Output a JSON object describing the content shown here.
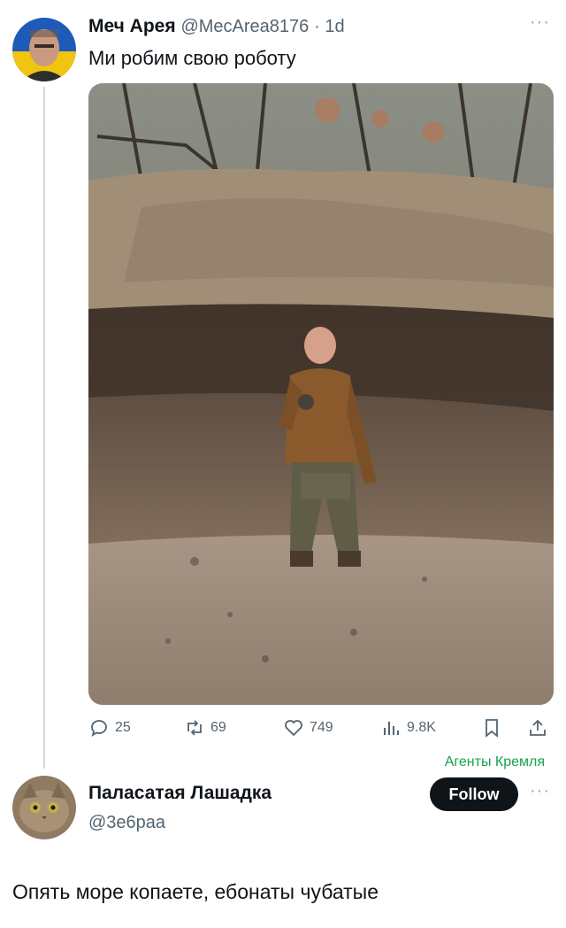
{
  "tweet": {
    "author_name": "Меч Арея",
    "author_handle": "@MecArea8176",
    "time": "· 1d",
    "text": "Ми робим свою роботу",
    "more_label": "···",
    "stats": {
      "replies": "25",
      "reposts": "69",
      "likes": "749",
      "views": "9.8K"
    },
    "icons": [
      "reply-icon",
      "retweet-icon",
      "heart-icon",
      "views-icon",
      "bookmark-icon",
      "share-icon"
    ]
  },
  "overlay_label": "Агенты Кремля",
  "reply_user": {
    "name": "Паласатая Лашадка",
    "handle": "@3е6раа",
    "follow_label": "Follow",
    "more_label": "···"
  },
  "reply_text": "Опять море копаете, ебонаты чубатые",
  "colors": {
    "text": "#0f1419",
    "secondary": "#536471",
    "green_label": "#16a34a",
    "follow_bg": "#0f1419"
  }
}
